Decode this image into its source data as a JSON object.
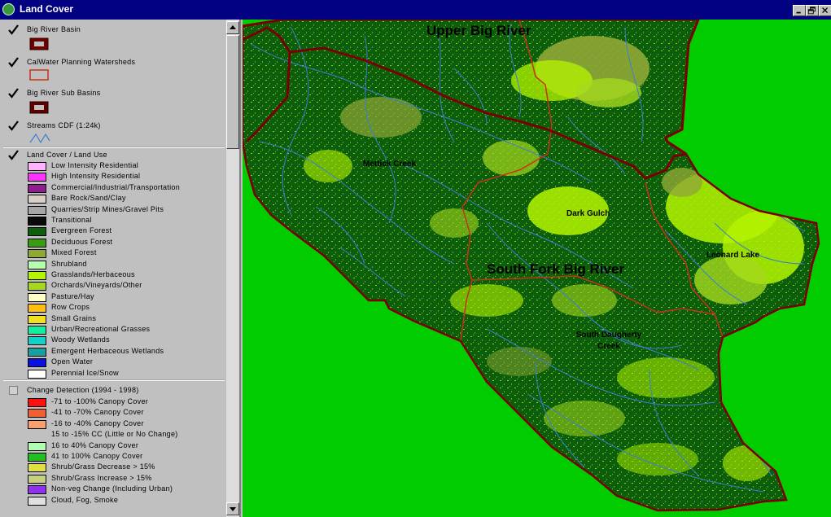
{
  "window": {
    "title": "Land Cover"
  },
  "toc": {
    "layers": [
      {
        "name": "Big River Basin",
        "checked": true,
        "symbol": {
          "type": "polygon",
          "fill": "#6b0000",
          "border": "#3a0000",
          "inner": "#c0c0c0"
        }
      },
      {
        "name": "CalWater Planning Watersheds",
        "checked": true,
        "symbol": {
          "type": "polygon-outline",
          "border": "#c83218"
        }
      },
      {
        "name": "Big River Sub Basins",
        "checked": true,
        "symbol": {
          "type": "polygon",
          "fill": "#5a0000",
          "border": "#2a0000",
          "inner": "#c0c0c0"
        }
      },
      {
        "name": "Streams CDF (1:24k)",
        "checked": true,
        "symbol": {
          "type": "line",
          "color": "#3a7fd0"
        }
      }
    ],
    "land_cover": {
      "name": "Land Cover / Land Use",
      "checked": true,
      "classes": [
        {
          "label": "Low Intensity Residential",
          "color": "#ffb3ff"
        },
        {
          "label": "High Intensity Residential",
          "color": "#ff33ff"
        },
        {
          "label": "Commercial/Industrial/Transportation",
          "color": "#8e1e8e"
        },
        {
          "label": "Bare Rock/Sand/Clay",
          "color": "#d9cfc4"
        },
        {
          "label": "Quarries/Strip Mines/Gravel Pits",
          "color": "#a6a6a6"
        },
        {
          "label": "Transitional",
          "color": "#0a0a0a"
        },
        {
          "label": "Evergreen Forest",
          "color": "#0b5e0b"
        },
        {
          "label": "Deciduous Forest",
          "color": "#3a9a10"
        },
        {
          "label": "Mixed Forest",
          "color": "#90a836"
        },
        {
          "label": "Shrubland",
          "color": "#b6ffb0"
        },
        {
          "label": "Grasslands/Herbaceous",
          "color": "#b5f500"
        },
        {
          "label": "Orchards/Vineyards/Other",
          "color": "#a5d81e"
        },
        {
          "label": "Pasture/Hay",
          "color": "#ffffc8"
        },
        {
          "label": "Row Crops",
          "color": "#ffbf10"
        },
        {
          "label": "Small Grains",
          "color": "#f0e020"
        },
        {
          "label": "Urban/Recreational Grasses",
          "color": "#10f0a0"
        },
        {
          "label": "Woody Wetlands",
          "color": "#10d0c8"
        },
        {
          "label": "Emergent Herbaceous Wetlands",
          "color": "#18a0a0"
        },
        {
          "label": "Open Water",
          "color": "#0a10e0"
        },
        {
          "label": "Perennial Ice/Snow",
          "color": "#ffffff"
        }
      ]
    },
    "change_detection": {
      "name": "Change Detection (1994 - 1998)",
      "checked": false,
      "classes": [
        {
          "label": "-71 to -100% Canopy Cover",
          "color": "#ff1010"
        },
        {
          "label": "-41 to -70% Canopy Cover",
          "color": "#f06030"
        },
        {
          "label": "-16 to -40% Canopy Cover",
          "color": "#f8a070"
        },
        {
          "label": "15 to -15% CC (Little or No Change)",
          "color": null
        },
        {
          "label": "16 to 40% Canopy Cover",
          "color": "#b0ffb0"
        },
        {
          "label": "41 to 100% Canopy Cover",
          "color": "#20c020"
        },
        {
          "label": "Shrub/Grass Decrease > 15%",
          "color": "#e0e040"
        },
        {
          "label": "Shrub/Grass Increase > 15%",
          "color": "#c8d080"
        },
        {
          "label": "Non-veg Change (Including Urban)",
          "color": "#9030f0"
        },
        {
          "label": "Cloud, Fog, Smoke",
          "color": "#e0e0e0"
        }
      ]
    }
  },
  "map": {
    "background_color": "#00cc00",
    "labels": {
      "upper_big_river": "Upper Big River",
      "mettick_creek": "Mettick Creek",
      "dark_gulch": "Dark Gulch",
      "south_fork_big_river": "South Fork Big River",
      "leonard_lake": "Leonard Lake",
      "south_daugherty_creek": "South Daugherty Creek"
    },
    "colors": {
      "forest": "#0b5e0b",
      "mixed": "#90a836",
      "grass": "#b5f500",
      "orchard": "#a5d81e",
      "stream": "#3a7fd0",
      "basin_boundary": "#7a0000",
      "watershed_boundary": "#c83218"
    }
  }
}
